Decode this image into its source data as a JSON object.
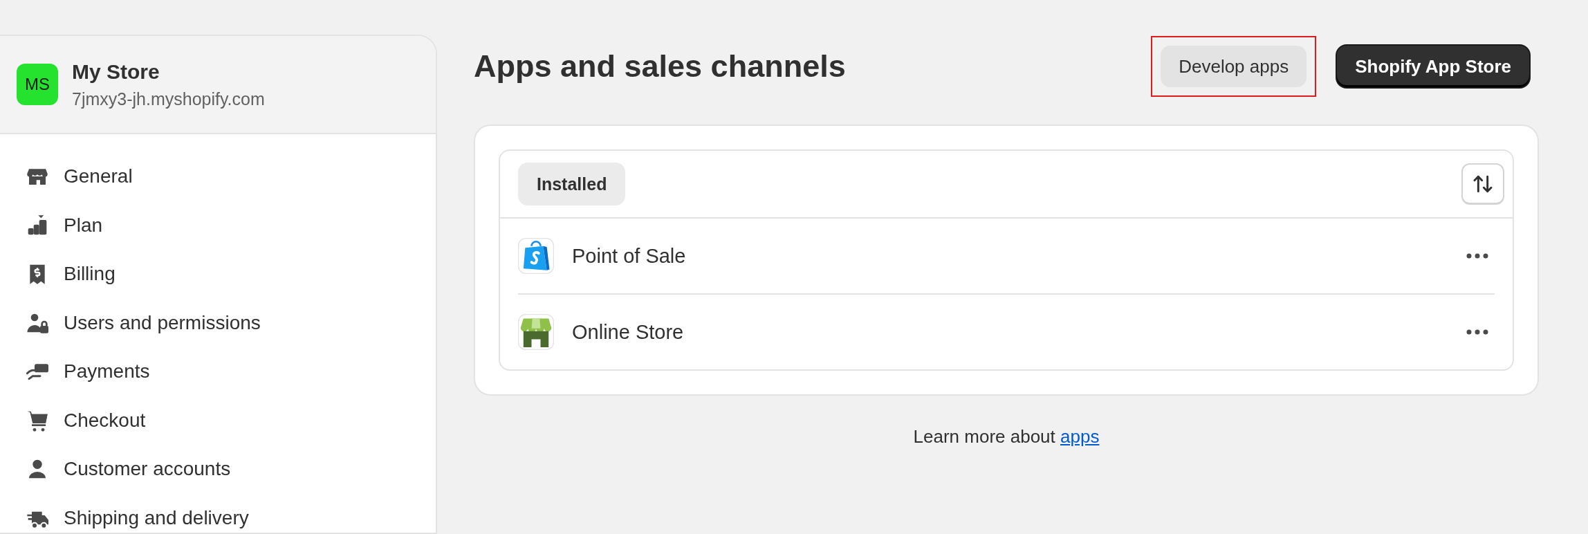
{
  "store": {
    "initials": "MS",
    "name": "My Store",
    "domain": "7jmxy3-jh.myshopify.com"
  },
  "sidebar": {
    "items": [
      {
        "label": "General"
      },
      {
        "label": "Plan"
      },
      {
        "label": "Billing"
      },
      {
        "label": "Users and permissions"
      },
      {
        "label": "Payments"
      },
      {
        "label": "Checkout"
      },
      {
        "label": "Customer accounts"
      },
      {
        "label": "Shipping and delivery"
      }
    ]
  },
  "page": {
    "title": "Apps and sales channels",
    "buttons": [
      {
        "label": "Develop apps",
        "kind": "secondary",
        "highlighted": true
      },
      {
        "label": "Shopify App Store",
        "kind": "primary",
        "highlighted": false
      }
    ]
  },
  "apps": {
    "tabs": [
      {
        "label": "Installed",
        "selected": true
      }
    ],
    "rows": [
      {
        "name": "Point of Sale"
      },
      {
        "name": "Online Store"
      }
    ]
  },
  "footer": {
    "text": "Learn more about ",
    "link": "apps"
  }
}
